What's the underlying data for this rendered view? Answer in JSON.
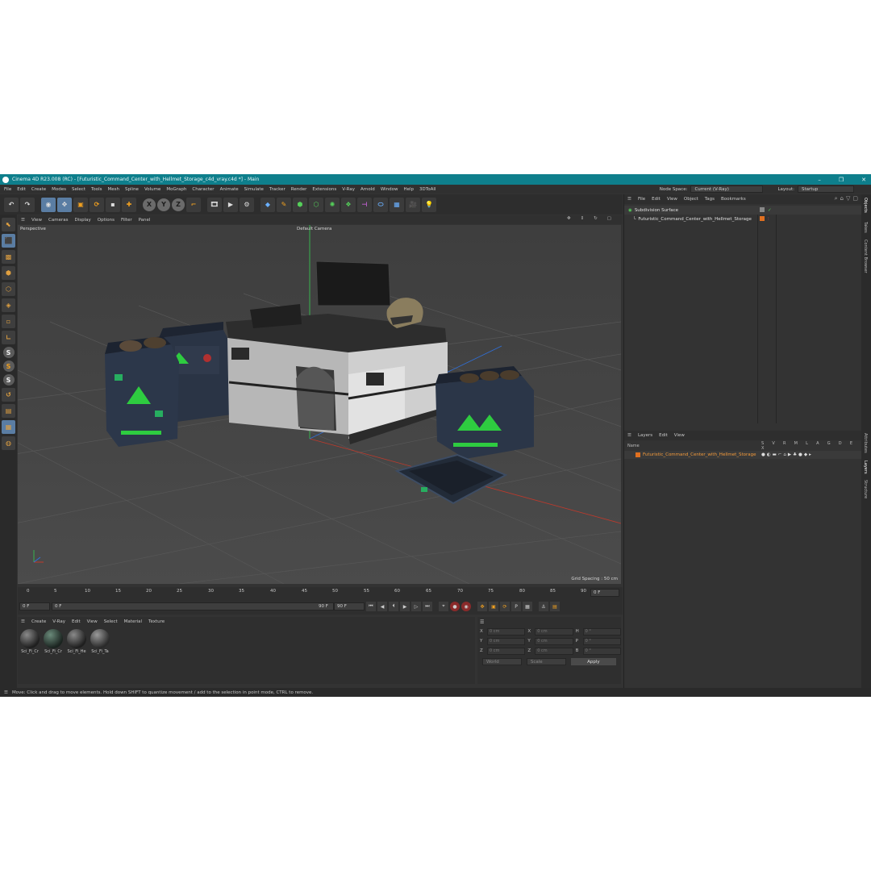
{
  "window": {
    "title": "Cinema 4D R23.008 (RC) - [Futuristic_Command_Center_with_Hellmet_Storage_c4d_vray.c4d *] - Main",
    "controls": [
      "–",
      "❐",
      "✕"
    ]
  },
  "menubar": {
    "items": [
      "File",
      "Edit",
      "Create",
      "Modes",
      "Select",
      "Tools",
      "Mesh",
      "Spline",
      "Volume",
      "MoGraph",
      "Character",
      "Animate",
      "Simulate",
      "Tracker",
      "Render",
      "Extensions",
      "V-Ray",
      "Arnold",
      "Window",
      "Help",
      "3DToAll"
    ],
    "node_space_label": "Node Space:",
    "node_space_value": "Current (V-Ray)",
    "layout_label": "Layout:",
    "layout_value": "Startup"
  },
  "toolbar": {
    "icons": [
      "undo-icon",
      "redo-icon",
      "live-select-icon",
      "move-icon",
      "scale-icon",
      "rotate-icon",
      "recent-icon",
      "add-icon",
      "x-axis-icon",
      "y-axis-icon",
      "z-axis-icon",
      "coordinate-system-icon",
      "render-region-icon",
      "render-view-icon",
      "render-settings-icon",
      "cube-icon",
      "pen-icon",
      "subdivision-icon",
      "extrude-icon",
      "cloner-icon",
      "deformer-icon",
      "field-icon",
      "scene-icon",
      "camera-icon",
      "light-icon"
    ],
    "x": "X",
    "y": "Y",
    "z": "Z"
  },
  "viewport": {
    "menu": [
      "View",
      "Cameras",
      "Display",
      "Options",
      "Filter",
      "Panel"
    ],
    "perspective": "Perspective",
    "camera": "Default Camera",
    "grid_spacing": "Grid Spacing : 50 cm"
  },
  "timeline": {
    "ticks": [
      "0",
      "5",
      "10",
      "15",
      "20",
      "25",
      "30",
      "35",
      "40",
      "45",
      "50",
      "55",
      "60",
      "65",
      "70",
      "75",
      "80",
      "85",
      "90"
    ],
    "current_frame": "0 F",
    "start_field": "0 F",
    "min_field": "0 F",
    "max_field": "90 F",
    "end_field": "90 F"
  },
  "materials": {
    "menu": [
      "Create",
      "V-Ray",
      "Edit",
      "View",
      "Select",
      "Material",
      "Texture"
    ],
    "items": [
      "Sci_Fi_Cr",
      "Sci_Fi_Cr",
      "Sci_Fi_He",
      "Sci_Fi_Ta"
    ]
  },
  "coordinates": {
    "rows": [
      {
        "a": "X",
        "av": "0 cm",
        "b": "X",
        "bv": "0 cm",
        "c": "H",
        "cv": "0 °"
      },
      {
        "a": "Y",
        "av": "0 cm",
        "b": "Y",
        "bv": "0 cm",
        "c": "P",
        "cv": "0 °"
      },
      {
        "a": "Z",
        "av": "0 cm",
        "b": "Z",
        "bv": "0 cm",
        "c": "B",
        "cv": "0 °"
      }
    ],
    "mode": "World",
    "scale": "Scale",
    "apply": "Apply"
  },
  "objects": {
    "menu": [
      "File",
      "Edit",
      "View",
      "Object",
      "Tags",
      "Bookmarks"
    ],
    "rows": [
      "Subdivision Surface",
      "Futuristic_Command_Center_with_Hellmet_Storage"
    ]
  },
  "layers": {
    "menu": [
      "Layers",
      "Edit",
      "View"
    ],
    "name_header": "Name",
    "columns": "S V R M L A G D E X",
    "row": "Futuristic_Command_Center_with_Hellmet_Storage"
  },
  "side_tabs": [
    "Objects",
    "Takes",
    "Content Browser",
    "Attributes",
    "Layers",
    "Structure"
  ],
  "status": "Move: Click and drag to move elements. Hold down SHIFT to quantize movement / add to the selection in point mode, CTRL to remove."
}
